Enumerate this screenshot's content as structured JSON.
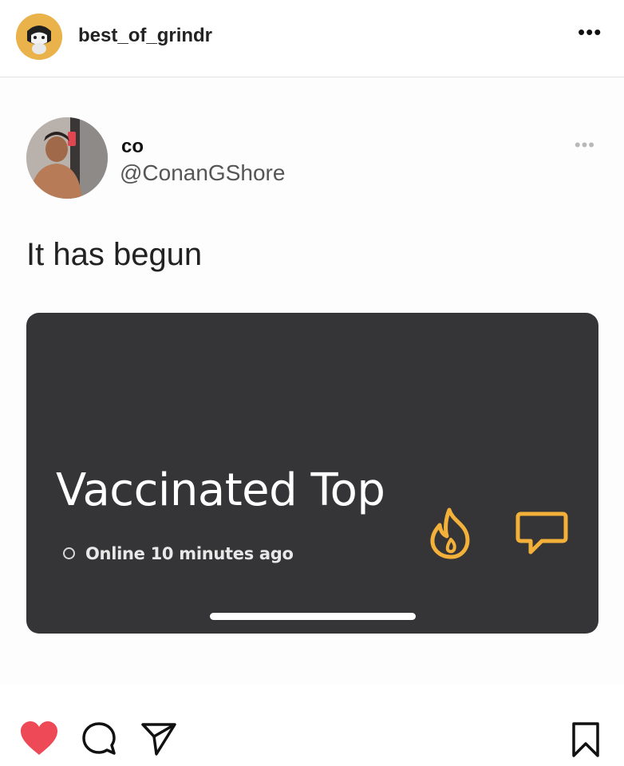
{
  "post_header": {
    "username": "best_of_grindr",
    "more_label": "•••",
    "avatar_icon": "gasmask-avatar-icon"
  },
  "tweet": {
    "display_name": "co",
    "handle": "@ConanGShore",
    "more_label": "•••",
    "text": "It has begun"
  },
  "profile_card": {
    "title": "Vaccinated Top",
    "status": "Online 10 minutes ago",
    "accent_color": "#f3b13a",
    "background_color": "#353436"
  },
  "actions": {
    "like_color": "#ed4956",
    "icons": [
      "heart-icon",
      "comment-icon",
      "share-icon",
      "bookmark-icon"
    ]
  }
}
